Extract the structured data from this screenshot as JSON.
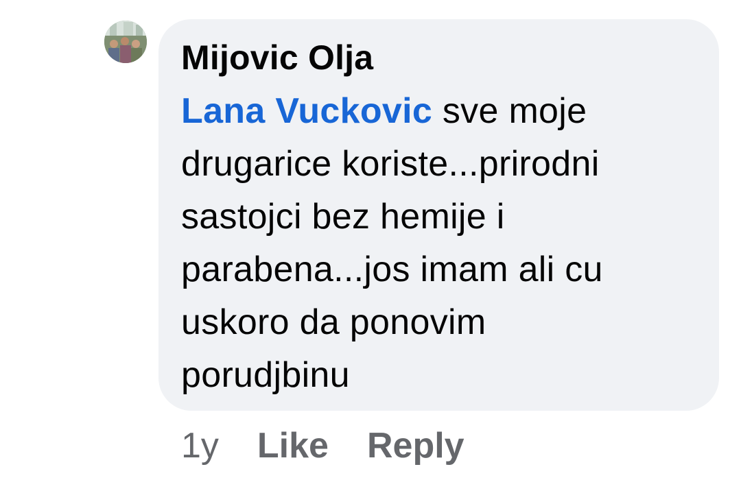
{
  "comment": {
    "author": "Mijovic Olja",
    "mention": "Lana Vuckovic",
    "text_lines": [
      " sve moje",
      "drugarice koriste...prirodni",
      "sastojci bez hemije i",
      "parabena...jos imam ali cu",
      "uskoro da ponovim",
      "porudjbinu"
    ],
    "avatar_icon": "profile-photo-avatar"
  },
  "actions": {
    "time": "1y",
    "like_label": "Like",
    "reply_label": "Reply"
  },
  "colors": {
    "bubble_bg": "#f0f2f5",
    "mention": "#1866d6",
    "text": "#050505",
    "secondary": "#65676b"
  }
}
